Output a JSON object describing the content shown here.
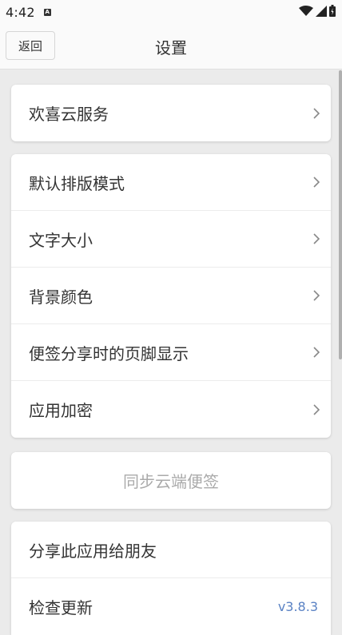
{
  "status_bar": {
    "time": "4:42",
    "notification_icon": "A"
  },
  "header": {
    "back_label": "返回",
    "title": "设置"
  },
  "groups": [
    {
      "items": [
        {
          "label": "欢喜云服务"
        }
      ]
    },
    {
      "items": [
        {
          "label": "默认排版模式"
        },
        {
          "label": "文字大小"
        },
        {
          "label": "背景颜色"
        },
        {
          "label": "便签分享时的页脚显示"
        },
        {
          "label": "应用加密"
        }
      ]
    },
    {
      "sync_label": "同步云端便签"
    },
    {
      "items": [
        {
          "label": "分享此应用给朋友"
        },
        {
          "label": "检查更新",
          "value": "v3.8.3"
        }
      ]
    }
  ],
  "colors": {
    "accent_link": "#5a82c4",
    "background": "#ebebeb"
  },
  "icons": [
    "wifi-icon",
    "signal-icon",
    "battery-icon",
    "chevron-right-icon"
  ]
}
